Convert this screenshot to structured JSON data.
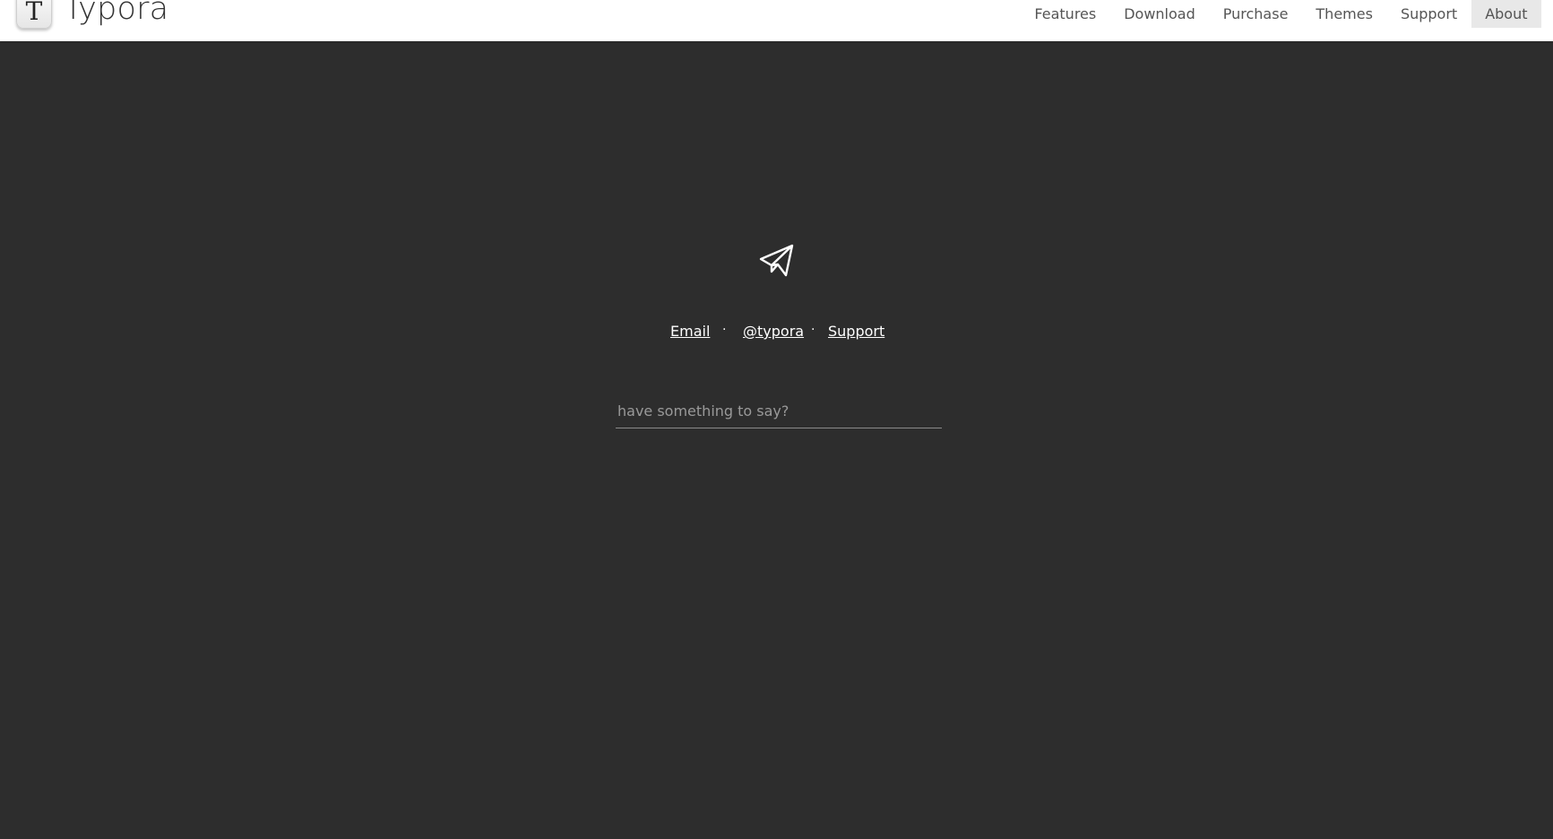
{
  "header": {
    "logo_letter": "T",
    "brand": "Typora",
    "nav": [
      {
        "label": "Features"
      },
      {
        "label": "Download"
      },
      {
        "label": "Purchase"
      },
      {
        "label": "Themes"
      },
      {
        "label": "Support"
      },
      {
        "label": "About",
        "active": true
      }
    ]
  },
  "main": {
    "icon": "paper-plane-icon",
    "contact_links": [
      {
        "label": "Email"
      },
      {
        "label": "@typora"
      },
      {
        "label": "Support"
      }
    ],
    "separator": "·",
    "message_input": {
      "placeholder": "have something to say?",
      "value": ""
    }
  },
  "colors": {
    "page_background": "#2d2d2d",
    "header_background": "#ffffff",
    "active_nav_background": "#e8e8e8",
    "link_color": "#ffffff"
  }
}
